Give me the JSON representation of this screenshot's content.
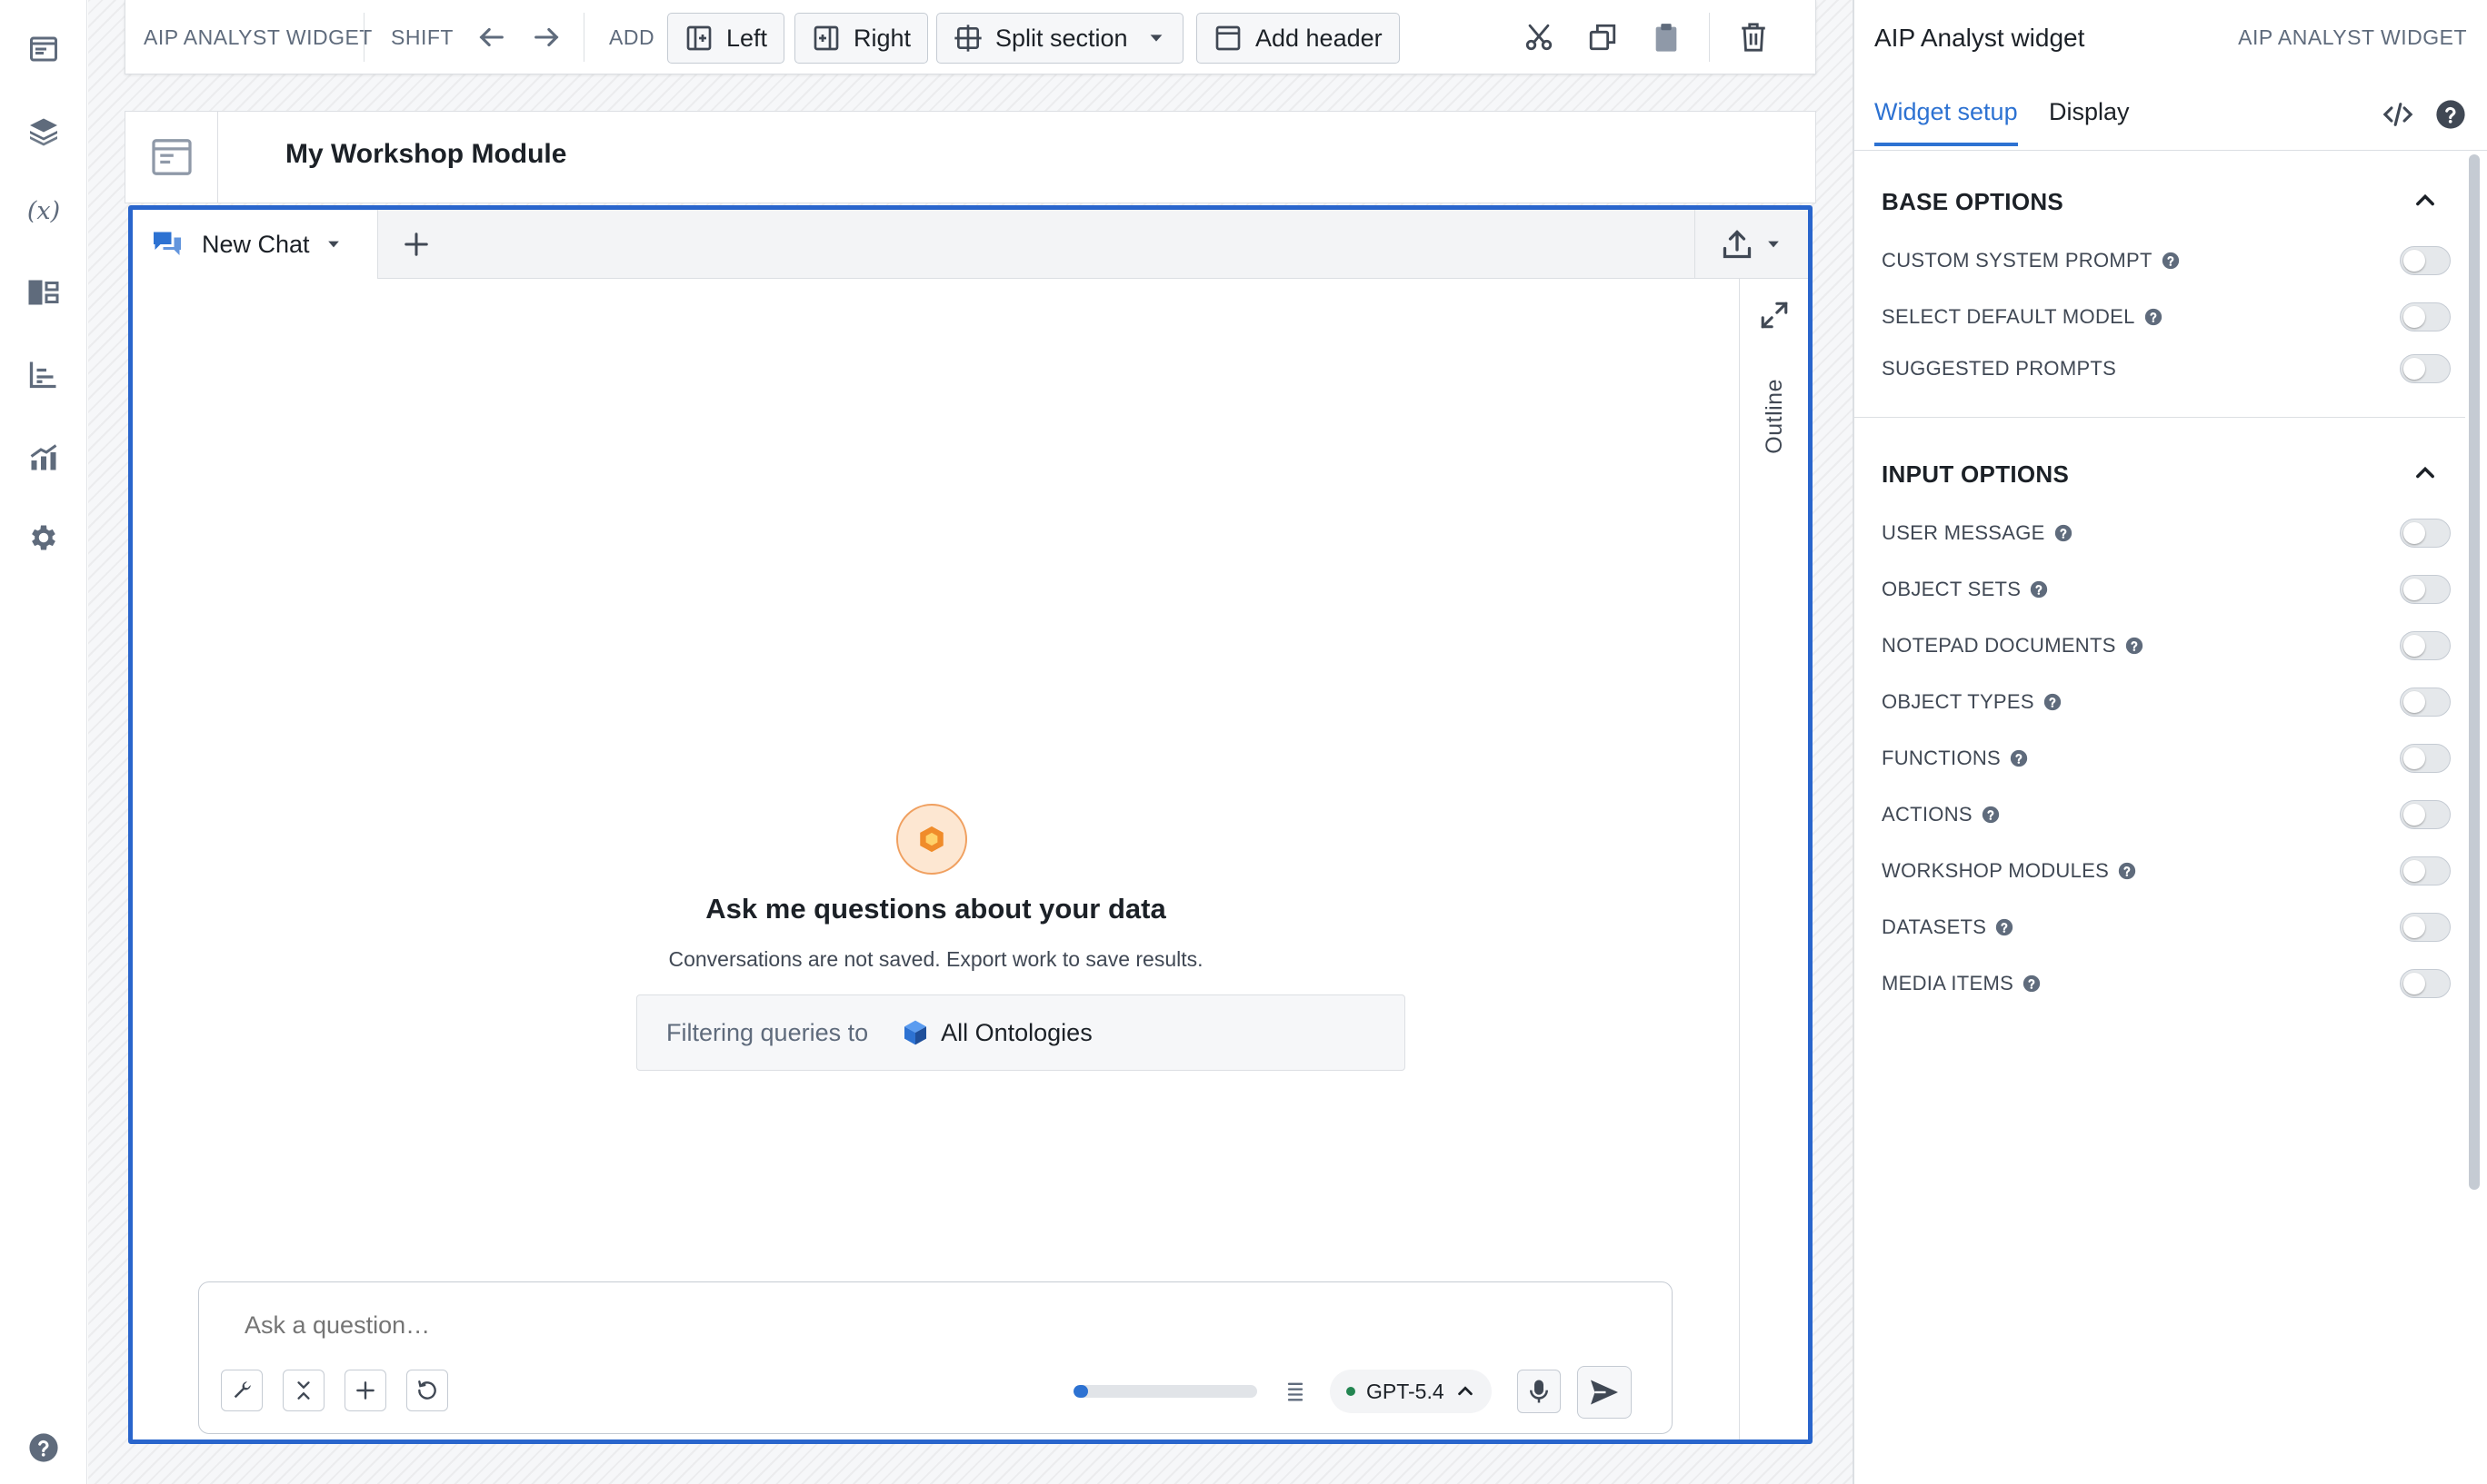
{
  "toolbar": {
    "widget_type": "AIP ANALYST WIDGET",
    "shift_label": "SHIFT",
    "add_label": "ADD",
    "left_label": "Left",
    "right_label": "Right",
    "split_label": "Split section",
    "header_label": "Add header"
  },
  "module": {
    "title": "My Workshop Module"
  },
  "chat": {
    "tab_label": "New Chat",
    "outline_label": "Outline",
    "empty_title": "Ask me questions about your data",
    "empty_subtitle": "Conversations are not saved. Export work to save results.",
    "filter_label": "Filtering queries to",
    "filter_value": "All Ontologies",
    "input_placeholder": "Ask a question…",
    "context_usage_fraction": 0.08,
    "model_label": "GPT-5.4",
    "model_status_color": "#238551"
  },
  "panel": {
    "title": "AIP Analyst widget",
    "type_label": "AIP ANALYST WIDGET",
    "tabs": [
      "Widget setup",
      "Display"
    ],
    "active_tab": "Widget setup",
    "sections": [
      {
        "title": "BASE OPTIONS",
        "options": [
          {
            "label": "CUSTOM SYSTEM PROMPT",
            "help": true,
            "enabled": false
          },
          {
            "label": "SELECT DEFAULT MODEL",
            "help": true,
            "enabled": false
          },
          {
            "label": "SUGGESTED PROMPTS",
            "help": false,
            "enabled": false
          }
        ]
      },
      {
        "title": "INPUT OPTIONS",
        "options": [
          {
            "label": "USER MESSAGE",
            "help": true,
            "enabled": false
          },
          {
            "label": "OBJECT SETS",
            "help": true,
            "enabled": false
          },
          {
            "label": "NOTEPAD DOCUMENTS",
            "help": true,
            "enabled": false
          },
          {
            "label": "OBJECT TYPES",
            "help": true,
            "enabled": false
          },
          {
            "label": "FUNCTIONS",
            "help": true,
            "enabled": false
          },
          {
            "label": "ACTIONS",
            "help": true,
            "enabled": false
          },
          {
            "label": "WORKSHOP MODULES",
            "help": true,
            "enabled": false
          },
          {
            "label": "DATASETS",
            "help": true,
            "enabled": false
          },
          {
            "label": "MEDIA ITEMS",
            "help": true,
            "enabled": false
          }
        ]
      }
    ]
  },
  "rail": {
    "variables_label": "(x)"
  },
  "colors": {
    "accent": "#2d72d2",
    "selection_border": "#2965cc",
    "aip_logo": "#f08c2a"
  }
}
